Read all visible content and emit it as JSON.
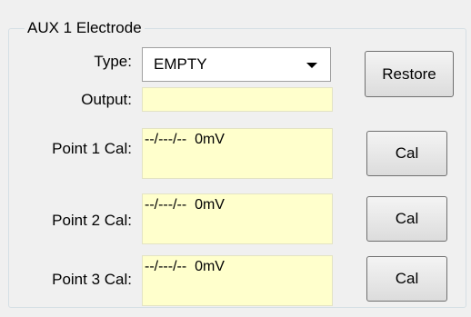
{
  "group": {
    "title": "AUX 1 Electrode"
  },
  "type_row": {
    "label": "Type:",
    "selected": "EMPTY",
    "dropdown_icon": "chevron-down-icon"
  },
  "restore_label": "Restore",
  "output_row": {
    "label": "Output:",
    "value": ""
  },
  "points": [
    {
      "label": "Point 1 Cal:",
      "value": "--/---/--  0mV",
      "button": "Cal"
    },
    {
      "label": "Point 2 Cal:",
      "value": "--/---/--  0mV",
      "button": "Cal"
    },
    {
      "label": "Point 3 Cal:",
      "value": "--/---/--  0mV",
      "button": "Cal"
    }
  ]
}
